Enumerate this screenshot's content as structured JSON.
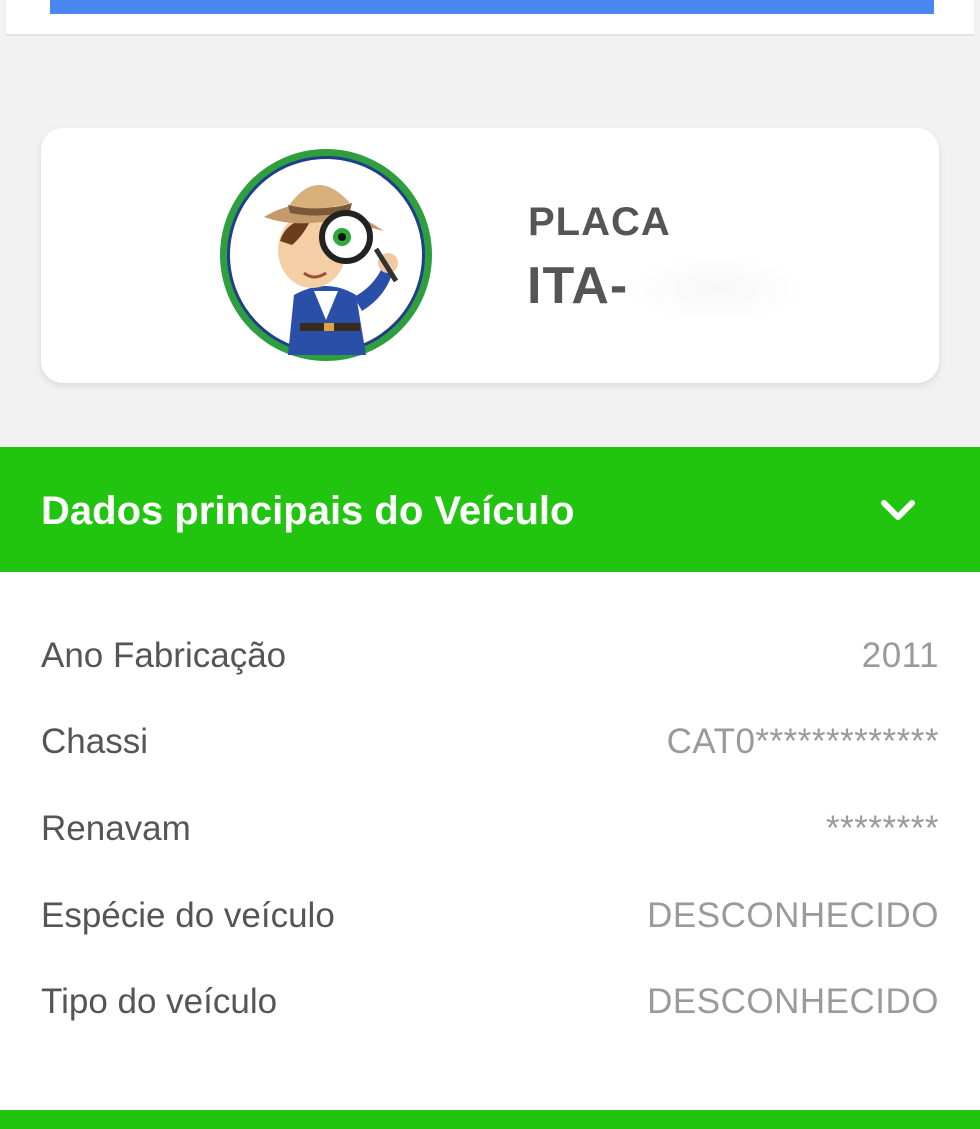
{
  "plate": {
    "label": "PLACA",
    "value": "ITA-"
  },
  "section": {
    "title": "Dados principais do Veículo",
    "toggle_icon": "chevron-down-icon"
  },
  "details": {
    "rows": [
      {
        "label": "Ano Fabricação",
        "value": "2011"
      },
      {
        "label": "Chassi",
        "value": "CAT0*************"
      },
      {
        "label": "Renavam",
        "value": "********"
      },
      {
        "label": "Espécie do veículo",
        "value": "DESCONHECIDO"
      },
      {
        "label": "Tipo do veículo",
        "value": "DESCONHECIDO"
      }
    ]
  },
  "colors": {
    "accent_green": "#21c40e",
    "top_blue": "#4a86f0",
    "label_gray": "#555555",
    "value_gray": "#9a9a9a"
  }
}
